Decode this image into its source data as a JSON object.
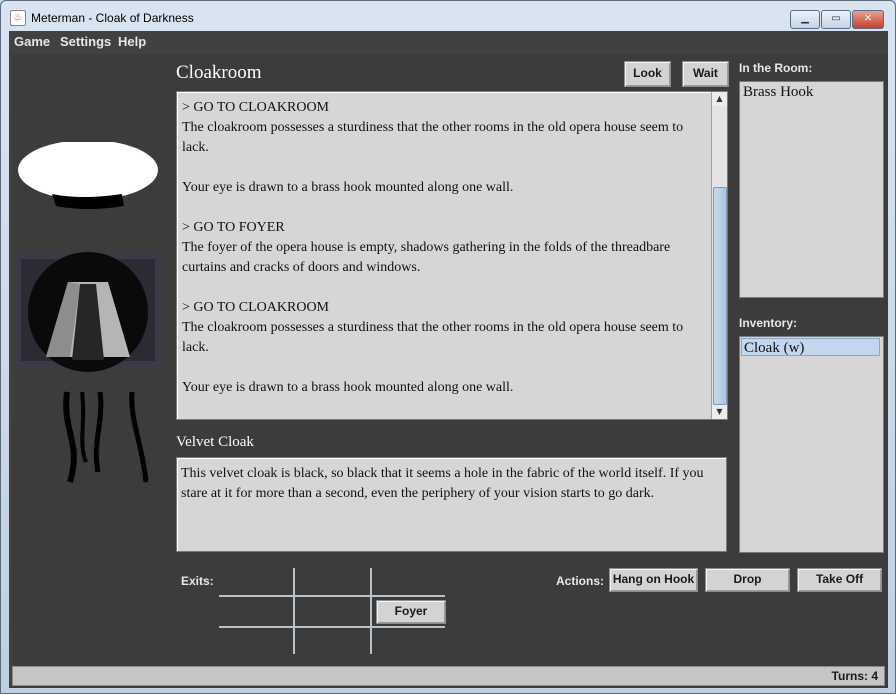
{
  "window": {
    "title": "Meterman - Cloak of Darkness"
  },
  "menu": {
    "items": [
      "Game",
      "Settings",
      "Help"
    ]
  },
  "room": {
    "title": "Cloakroom"
  },
  "toolbar": {
    "look_label": "Look",
    "wait_label": "Wait"
  },
  "story": {
    "lines": [
      "> GO TO CLOAKROOM",
      "The cloakroom possesses a sturdiness that the other rooms in the old opera house seem to lack.",
      "Your eye is drawn to a brass hook mounted along one wall.",
      "> GO TO FOYER",
      "The foyer of the opera house is empty, shadows gathering in the folds of the threadbare curtains and cracks of doors and windows.",
      "> GO TO CLOAKROOM",
      "The cloakroom possesses a sturdiness that the other rooms in the old opera house seem to lack.",
      "Your eye is drawn to a brass hook mounted along one wall."
    ]
  },
  "item": {
    "title": "Velvet Cloak",
    "description": "This velvet cloak is black, so black that it seems a hole in the fabric of the world itself. If you stare at it for more than a second, even the periphery of your vision starts to go dark."
  },
  "sidebar": {
    "room_label": "In the Room:",
    "room_items": [
      "Brass Hook"
    ],
    "inventory_label": "Inventory:",
    "inventory_items": [
      "Cloak (w)"
    ]
  },
  "exits": {
    "label": "Exits:",
    "foyer_label": "Foyer"
  },
  "actions": {
    "label": "Actions:",
    "hang_label": "Hang on Hook",
    "drop_label": "Drop",
    "takeoff_label": "Take Off"
  },
  "status": {
    "turns": "Turns: 4"
  },
  "colors": {
    "background": "#3c3c3c",
    "panel": "#d6d6d6",
    "selection": "#c3d6ee"
  },
  "icons": {
    "portrait": "cloak-portrait-icon",
    "app": "java-app-icon"
  }
}
